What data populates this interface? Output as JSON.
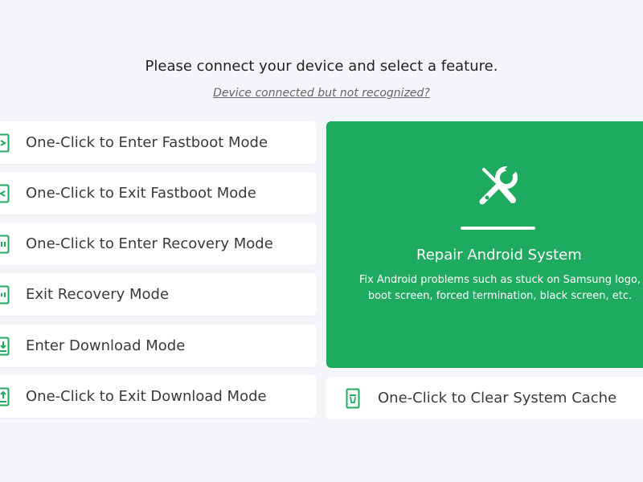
{
  "header": {
    "prompt": "Please connect your device and select a feature.",
    "help_link": "Device connected but not recognized?"
  },
  "features": [
    {
      "label": "One-Click to Enter Fastboot Mode",
      "icon": "phone-enter-fastboot-icon"
    },
    {
      "label": "One-Click to Exit Fastboot Mode",
      "icon": "phone-exit-fastboot-icon"
    },
    {
      "label": "One-Click to Enter Recovery Mode",
      "icon": "phone-enter-recovery-icon"
    },
    {
      "label": "Exit Recovery Mode",
      "icon": "phone-exit-recovery-icon"
    },
    {
      "label": "Enter Download Mode",
      "icon": "phone-download-icon"
    },
    {
      "label": "One-Click to Exit Download Mode",
      "icon": "phone-exit-download-icon"
    }
  ],
  "repair": {
    "title": "Repair Android System",
    "description_line1": "Fix Android problems such as stuck on Samsung logo,",
    "description_line2": "boot screen, forced termination, black screen, etc.",
    "icon": "tools-icon"
  },
  "cache": {
    "label": "One-Click to Clear System Cache",
    "icon": "clear-cache-icon"
  },
  "colors": {
    "accent": "#1eaa5f",
    "background": "#f4f5f8",
    "card": "#ffffff",
    "text": "#3a3a3a"
  }
}
